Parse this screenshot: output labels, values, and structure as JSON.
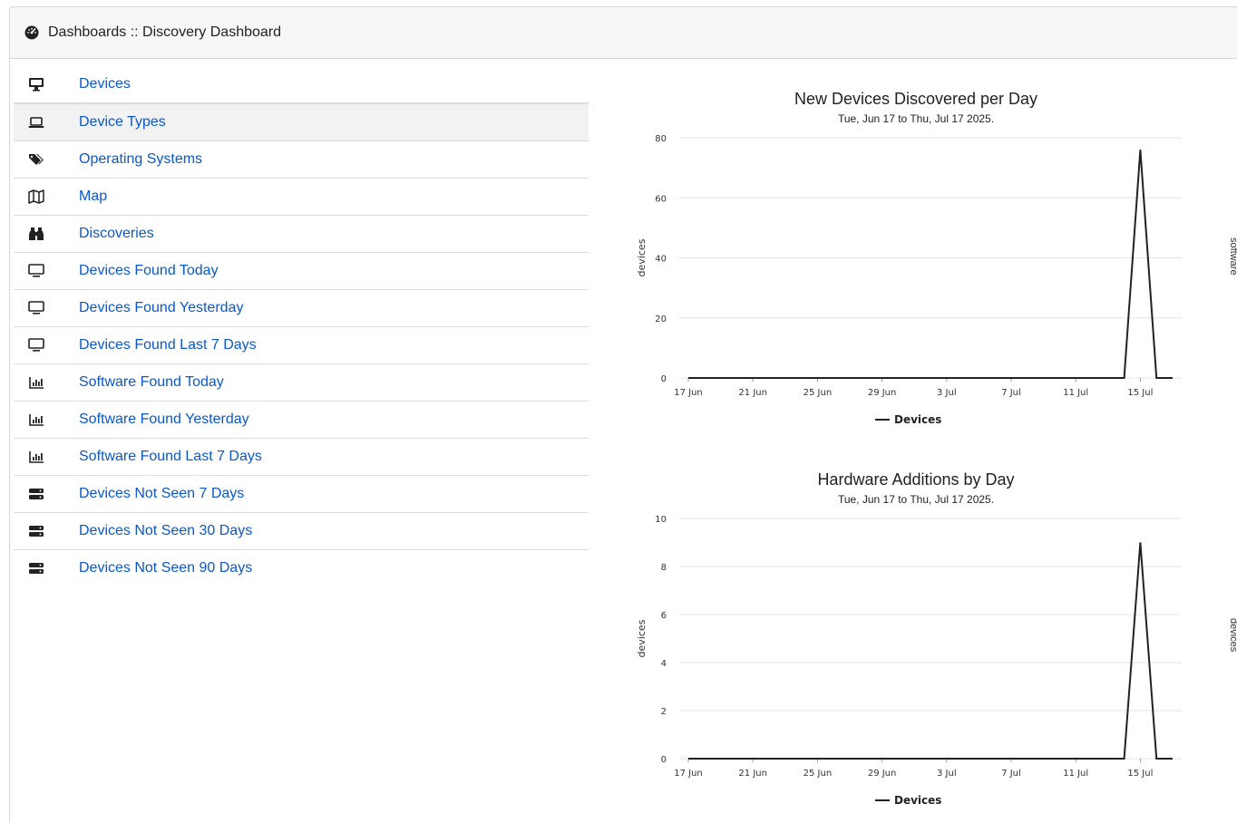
{
  "header": {
    "title": "Dashboards :: Discovery Dashboard",
    "icon": "dashboard-gauge-icon"
  },
  "menu": {
    "items": [
      {
        "label": "Devices",
        "icon": "desktop-icon"
      },
      {
        "label": "Device Types",
        "icon": "laptop-icon",
        "active": true
      },
      {
        "label": "Operating Systems",
        "icon": "tags-icon"
      },
      {
        "label": "Map",
        "icon": "map-icon"
      },
      {
        "label": "Discoveries",
        "icon": "binoculars-icon"
      },
      {
        "label": "Devices Found Today",
        "icon": "monitor-icon"
      },
      {
        "label": "Devices Found Yesterday",
        "icon": "monitor-icon"
      },
      {
        "label": "Devices Found Last 7 Days",
        "icon": "monitor-icon"
      },
      {
        "label": "Software Found Today",
        "icon": "bar-chart-icon"
      },
      {
        "label": "Software Found Yesterday",
        "icon": "bar-chart-icon"
      },
      {
        "label": "Software Found Last 7 Days",
        "icon": "bar-chart-icon"
      },
      {
        "label": "Devices Not Seen 7 Days",
        "icon": "server-icon"
      },
      {
        "label": "Devices Not Seen 30 Days",
        "icon": "server-icon"
      },
      {
        "label": "Devices Not Seen 90 Days",
        "icon": "server-icon"
      }
    ]
  },
  "edge_labels": [
    "software",
    "devices"
  ],
  "chart_data": [
    {
      "type": "line",
      "title": "New Devices Discovered per Day",
      "subtitle": "Tue, Jun 17 to Thu, Jul 17 2025.",
      "xlabel": "",
      "ylabel": "devices",
      "ylim": [
        0,
        80
      ],
      "yticks": [
        0,
        20,
        40,
        60,
        80
      ],
      "xticks": [
        "17 Jun",
        "21 Jun",
        "25 Jun",
        "29 Jun",
        "3 Jul",
        "7 Jul",
        "11 Jul",
        "15 Jul"
      ],
      "grid": true,
      "legend": "bottom-center",
      "color": "#222222",
      "series": [
        {
          "name": "Devices",
          "x": [
            "17 Jun",
            "18 Jun",
            "19 Jun",
            "20 Jun",
            "21 Jun",
            "22 Jun",
            "23 Jun",
            "24 Jun",
            "25 Jun",
            "26 Jun",
            "27 Jun",
            "28 Jun",
            "29 Jun",
            "30 Jun",
            "1 Jul",
            "2 Jul",
            "3 Jul",
            "4 Jul",
            "5 Jul",
            "6 Jul",
            "7 Jul",
            "8 Jul",
            "9 Jul",
            "10 Jul",
            "11 Jul",
            "12 Jul",
            "13 Jul",
            "14 Jul",
            "15 Jul",
            "16 Jul",
            "17 Jul"
          ],
          "values": [
            0,
            0,
            0,
            0,
            0,
            0,
            0,
            0,
            0,
            0,
            0,
            0,
            0,
            0,
            0,
            0,
            0,
            0,
            0,
            0,
            0,
            0,
            0,
            0,
            0,
            0,
            0,
            0,
            76,
            0,
            0
          ]
        }
      ]
    },
    {
      "type": "line",
      "title": "Hardware Additions by Day",
      "subtitle": "Tue, Jun 17 to Thu, Jul 17 2025.",
      "xlabel": "",
      "ylabel": "devices",
      "ylim": [
        0,
        10
      ],
      "yticks": [
        0,
        2,
        4,
        6,
        8,
        10
      ],
      "xticks": [
        "17 Jun",
        "21 Jun",
        "25 Jun",
        "29 Jun",
        "3 Jul",
        "7 Jul",
        "11 Jul",
        "15 Jul"
      ],
      "grid": true,
      "legend": "bottom-center",
      "color": "#222222",
      "series": [
        {
          "name": "Devices",
          "x": [
            "17 Jun",
            "18 Jun",
            "19 Jun",
            "20 Jun",
            "21 Jun",
            "22 Jun",
            "23 Jun",
            "24 Jun",
            "25 Jun",
            "26 Jun",
            "27 Jun",
            "28 Jun",
            "29 Jun",
            "30 Jun",
            "1 Jul",
            "2 Jul",
            "3 Jul",
            "4 Jul",
            "5 Jul",
            "6 Jul",
            "7 Jul",
            "8 Jul",
            "9 Jul",
            "10 Jul",
            "11 Jul",
            "12 Jul",
            "13 Jul",
            "14 Jul",
            "15 Jul",
            "16 Jul",
            "17 Jul"
          ],
          "values": [
            0,
            0,
            0,
            0,
            0,
            0,
            0,
            0,
            0,
            0,
            0,
            0,
            0,
            0,
            0,
            0,
            0,
            0,
            0,
            0,
            0,
            0,
            0,
            0,
            0,
            0,
            0,
            0,
            9,
            0,
            0
          ]
        }
      ]
    }
  ]
}
